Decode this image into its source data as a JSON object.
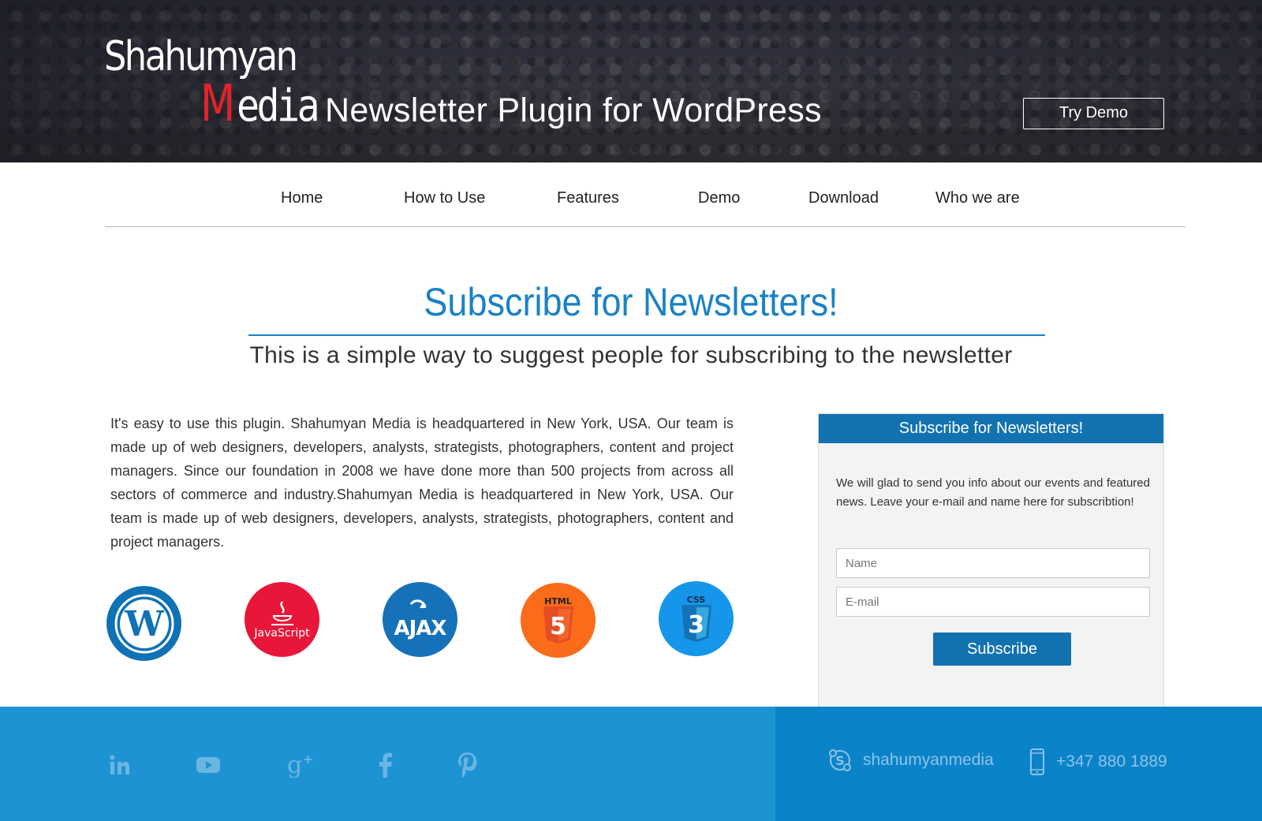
{
  "header": {
    "logo_top": "Shahumyan",
    "logo_bottom_m": "M",
    "logo_bottom_rest": "edia",
    "site_title": "Newsletter Plugin for WordPress",
    "try_demo_label": "Try Demo"
  },
  "nav": {
    "items": [
      {
        "label": "Home"
      },
      {
        "label": "How to Use"
      },
      {
        "label": "Features"
      },
      {
        "label": "Demo"
      },
      {
        "label": "Download"
      },
      {
        "label": "Who we are"
      }
    ]
  },
  "hero": {
    "title": "Subscribe for Newsletters!",
    "subtitle": "This is a simple way to suggest people for subscribing to the newsletter"
  },
  "body": {
    "paragraph": "It's easy to use this plugin. Shahumyan Media is headquartered in New York, USA. Our team is made up of web designers, developers, analysts, strategists, photographers, content and project managers. Since our foundation in 2008 we have done more than 500 projects from across all sectors of commerce and industry.Shahumyan Media is headquartered in New York, USA. Our team is made up of web designers, developers, analysts, strategists, photographers, content and project managers."
  },
  "tech_icons": [
    {
      "icon": "wordpress-icon",
      "color": "#0e72b5"
    },
    {
      "icon": "javascript-icon",
      "label": "JavaScript",
      "color": "#e8173a"
    },
    {
      "icon": "ajax-icon",
      "label": "AJAX",
      "color": "#1672b8"
    },
    {
      "icon": "html5-icon",
      "label": "HTML",
      "digit": "5",
      "color": "#fa6b1a"
    },
    {
      "icon": "css3-icon",
      "label": "CSS",
      "digit": "3",
      "color": "#1596ea"
    }
  ],
  "widget": {
    "title": "Subscribe for Newsletters!",
    "text": "We will glad to send you info about our events and featured news. Leave your e-mail and name here for subscribtion!",
    "name_placeholder": "Name",
    "email_placeholder": "E-mail",
    "subscribe_label": "Subscribe"
  },
  "footer": {
    "social_icons": [
      "linkedin-icon",
      "youtube-icon",
      "google-plus-icon",
      "facebook-icon",
      "pinterest-icon"
    ],
    "skype_name": "shahumyanmedia",
    "phone": "+347 880 1889"
  },
  "colors": {
    "accent_blue": "#1a82c6",
    "button_blue": "#1272b0",
    "logo_red": "#e3232b",
    "footer_left": "#1e93d3",
    "footer_right": "#0a83c9"
  }
}
